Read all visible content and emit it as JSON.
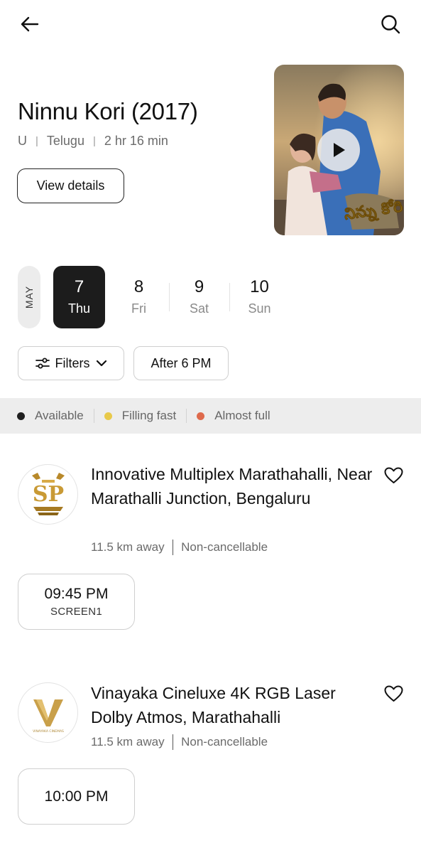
{
  "header": {
    "back_icon": "arrow-left-icon",
    "search_icon": "search-icon"
  },
  "movie": {
    "title": "Ninnu Kori (2017)",
    "rating": "U",
    "language": "Telugu",
    "duration": "2 hr 16 min",
    "view_details_label": "View details",
    "poster": {
      "play_icon": "play-icon",
      "logo_script": "నిన్ను కోరి"
    }
  },
  "dates": {
    "month": "MAY",
    "items": [
      {
        "num": "7",
        "day": "Thu",
        "selected": true
      },
      {
        "num": "8",
        "day": "Fri",
        "selected": false
      },
      {
        "num": "9",
        "day": "Sat",
        "selected": false
      },
      {
        "num": "10",
        "day": "Sun",
        "selected": false
      }
    ]
  },
  "filters": {
    "filters_label": "Filters",
    "time_label": "After 6 PM"
  },
  "legend": [
    {
      "label": "Available",
      "color": "#1f1f1f"
    },
    {
      "label": "Filling fast",
      "color": "#e8c94a"
    },
    {
      "label": "Almost full",
      "color": "#de6a4c"
    }
  ],
  "cinemas": [
    {
      "name": "Innovative Multiplex Marathahalli, Near Marathalli Junction, Bengaluru",
      "distance": "11.5 km away",
      "policy": "Non-cancellable",
      "logo_icon": "sp-gold-logo-icon",
      "showtimes": [
        {
          "time": "09:45 PM",
          "screen": "SCREEN1"
        }
      ]
    },
    {
      "name": "Vinayaka Cineluxe 4K RGB Laser Dolby Atmos, Marathahalli",
      "distance": "11.5 km away",
      "policy": "Non-cancellable",
      "logo_icon": "v-gold-logo-icon",
      "logo_text": "VINAYAKA CINEMAS",
      "showtimes": [
        {
          "time": "10:00 PM"
        }
      ]
    }
  ]
}
